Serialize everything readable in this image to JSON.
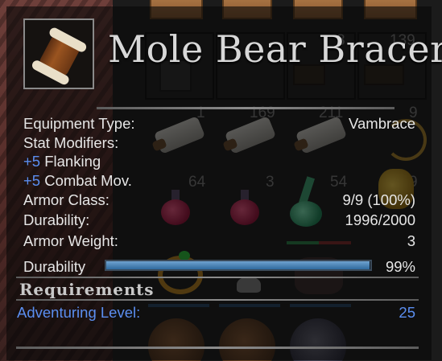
{
  "tooltip": {
    "item_name": "Mole Bear Bracer",
    "icon": "fur-bracer-icon",
    "stats": {
      "equipment_type_label": "Equipment Type:",
      "equipment_type_value": "Vambrace",
      "stat_modifiers_label": "Stat Modifiers:",
      "modifiers": [
        {
          "sign": "+5",
          "name": "Flanking"
        },
        {
          "sign": "+5",
          "name": "Combat Mov."
        }
      ],
      "armor_class_label": "Armor Class:",
      "armor_class_value": "9/9 (100%)",
      "durability_label": "Durability:",
      "durability_value": "1996/2000",
      "armor_weight_label": "Armor Weight:",
      "armor_weight_value": "3"
    },
    "durability_bar": {
      "label": "Durability",
      "percent_text": "99%",
      "fraction": 0.998
    },
    "requirements": {
      "heading": "Requirements",
      "adventuring_level_label": "Adventuring Level:",
      "adventuring_level_value": "25"
    }
  },
  "inventory_background": {
    "stack_counts": [
      "8",
      "139",
      "1",
      "169",
      "211",
      "9",
      "64",
      "3",
      "54",
      "9"
    ]
  },
  "colors": {
    "title": "#d8d8d8",
    "text": "#e6e6e6",
    "accent_blue": "#5b8ef0",
    "bar_fill": "#4a86bd"
  }
}
